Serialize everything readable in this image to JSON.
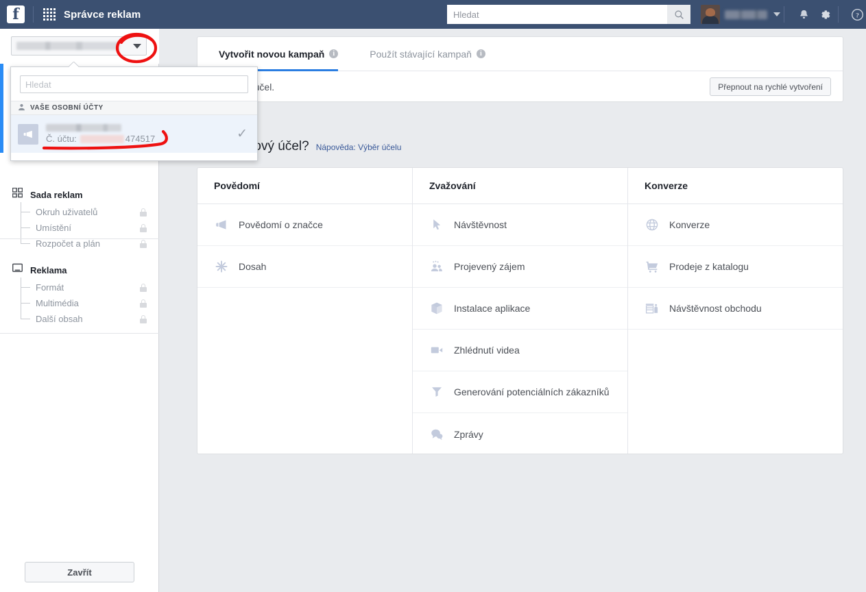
{
  "topbar": {
    "app_title": "Správce reklam",
    "logo_letter": "f",
    "grid_icon": "apps-grid-icon",
    "search": {
      "placeholder": "Hledat",
      "value": ""
    },
    "icons": {
      "search": "search-icon",
      "bell": "notifications-icon",
      "gear": "settings-icon",
      "help": "help-icon"
    }
  },
  "sidebar": {
    "account_selector": {
      "name_redacted": "",
      "caret": "chevron-down-icon"
    },
    "sections": [
      {
        "icon": "adset-grid-icon",
        "label": "Sada reklam",
        "items": [
          {
            "label": "Okruh uživatelů",
            "locked": true
          },
          {
            "label": "Umístění",
            "locked": true
          },
          {
            "label": "Rozpočet a plán",
            "locked": true
          }
        ]
      },
      {
        "icon": "ad-screen-icon",
        "label": "Reklama",
        "items": [
          {
            "label": "Formát",
            "locked": true
          },
          {
            "label": "Multimédia",
            "locked": true
          },
          {
            "label": "Další obsah",
            "locked": true
          }
        ]
      }
    ],
    "close_label": "Zavřít"
  },
  "account_dropdown": {
    "search": {
      "placeholder": "Hledat",
      "value": ""
    },
    "group_label": "VAŠE OSOBNÍ ÚČTY",
    "group_icon": "person-icon",
    "row": {
      "thumb_icon": "megaphone-icon",
      "name_redacted": "",
      "account_number_label": "Č. účtu:",
      "account_number_visible": "474517",
      "selected": true,
      "check_icon": "check-icon"
    }
  },
  "main": {
    "tabs": [
      {
        "label": "Vytvořit novou kampaň",
        "active": true,
        "info_icon": "info-icon"
      },
      {
        "label": "Použít stávající kampaň",
        "active": false,
        "info_icon": "info-icon"
      }
    ],
    "subbar_text": "Vyberte účel.",
    "quick_create_label": "Přepnout na rychlé vytvoření",
    "question_text": "marketingový účel?",
    "help_link": "Nápověda: Výběr účelu",
    "objective_columns": [
      {
        "header": "Povědomí",
        "items": [
          {
            "label": "Povědomí o značce",
            "icon": "megaphone-icon"
          },
          {
            "label": "Dosah",
            "icon": "reach-burst-icon"
          }
        ]
      },
      {
        "header": "Zvažování",
        "items": [
          {
            "label": "Návštěvnost",
            "icon": "cursor-arrow-icon"
          },
          {
            "label": "Projevený zájem",
            "icon": "people-engagement-icon"
          },
          {
            "label": "Instalace aplikace",
            "icon": "app-box-icon"
          },
          {
            "label": "Zhlédnutí videa",
            "icon": "video-camera-icon"
          },
          {
            "label": "Generování potenciálních zákazníků",
            "icon": "funnel-icon"
          },
          {
            "label": "Zprávy",
            "icon": "chat-bubbles-icon"
          }
        ]
      },
      {
        "header": "Konverze",
        "items": [
          {
            "label": "Konverze",
            "icon": "globe-icon"
          },
          {
            "label": "Prodeje z katalogu",
            "icon": "shopping-cart-icon"
          },
          {
            "label": "Návštěvnost obchodu",
            "icon": "store-icon"
          }
        ]
      }
    ]
  },
  "annotations": {
    "circle_target": "account-selector-caret",
    "underline_target": "account-number",
    "color": "#ee1111"
  },
  "colors": {
    "topbar": "#3b5071",
    "accent_blue": "#2a7de1",
    "rail_blue": "#2a8cf5",
    "page_bg": "#e9ebee",
    "card_bg": "#ffffff",
    "muted_text": "#8d949e",
    "link": "#385898",
    "annotation_red": "#ee1111"
  }
}
